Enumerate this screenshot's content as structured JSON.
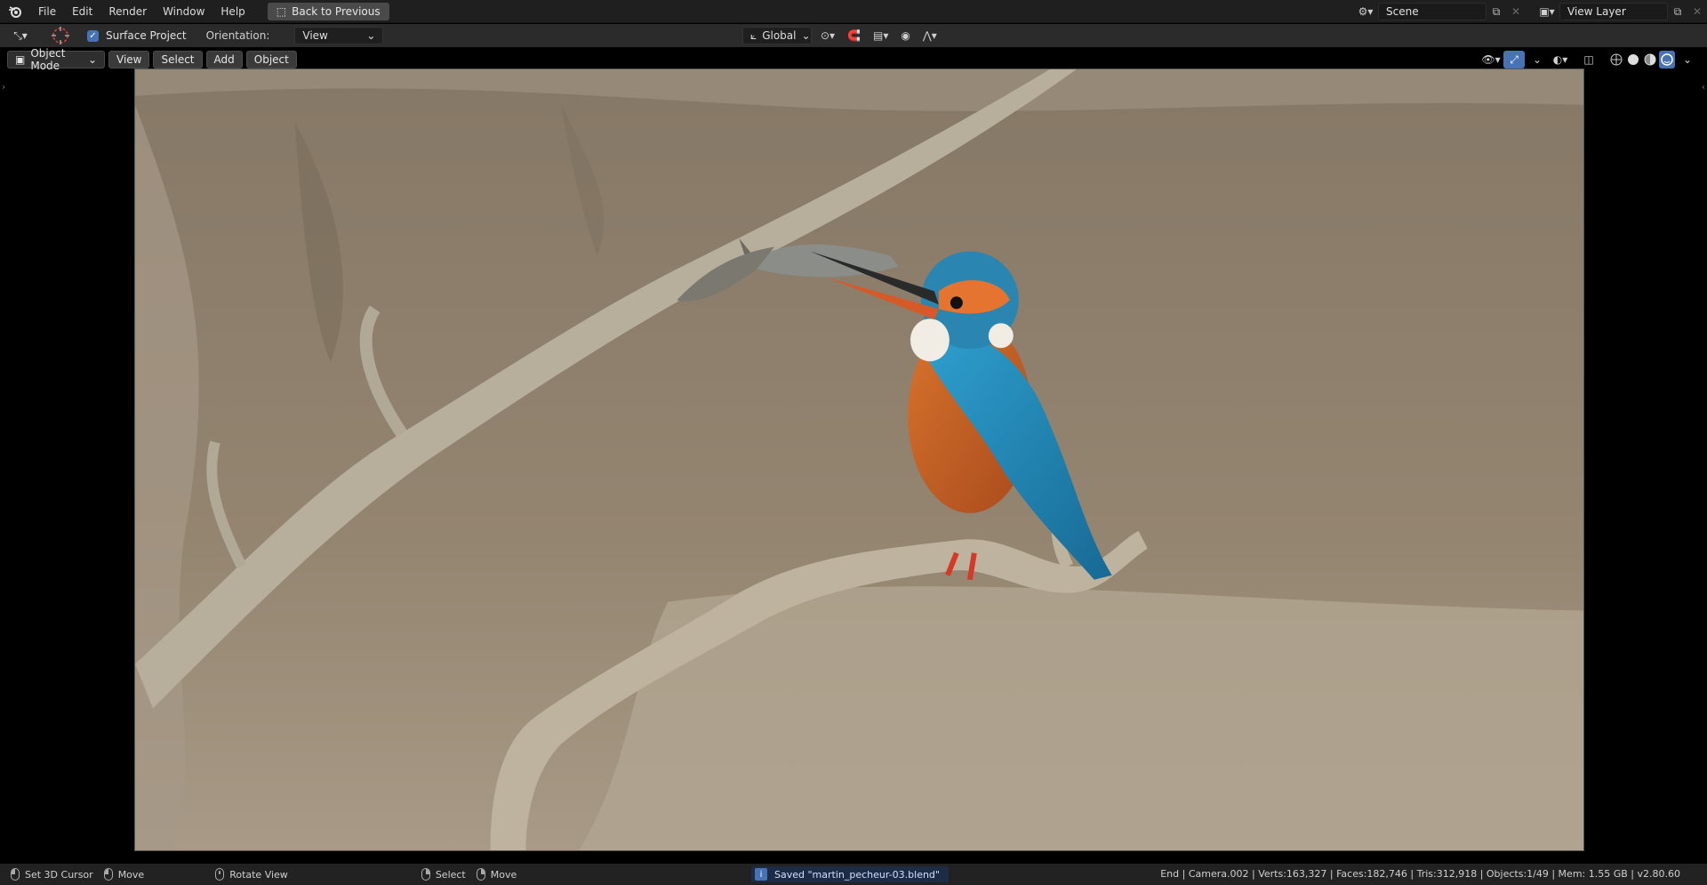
{
  "topbar": {
    "menu": [
      "File",
      "Edit",
      "Render",
      "Window",
      "Help"
    ],
    "back_button": "Back to Previous",
    "scene": "Scene",
    "view_layer": "View Layer"
  },
  "toolbar": {
    "surface_project": "Surface Project",
    "orientation_label": "Orientation:",
    "orientation_value": "View",
    "transform_orientation": "Global"
  },
  "viewport": {
    "mode": "Object Mode",
    "menus": [
      "View",
      "Select",
      "Add",
      "Object"
    ]
  },
  "statusbar": {
    "left_click": "Set 3D Cursor",
    "left_move": "Move",
    "middle": "Rotate View",
    "right_select": "Select",
    "right_move": "Move",
    "message": "Saved \"martin_pecheur-03.blend\"",
    "stats": "End | Camera.002 | Verts:163,327 | Faces:182,746 | Tris:312,918 | Objects:1/49 | Mem: 1.55 GB | v2.80.60"
  },
  "colors": {
    "accent": "#4772b3",
    "header_bg": "#1f1f1f",
    "toolbar_bg": "#2b2b2b",
    "status_bg": "#222222"
  }
}
